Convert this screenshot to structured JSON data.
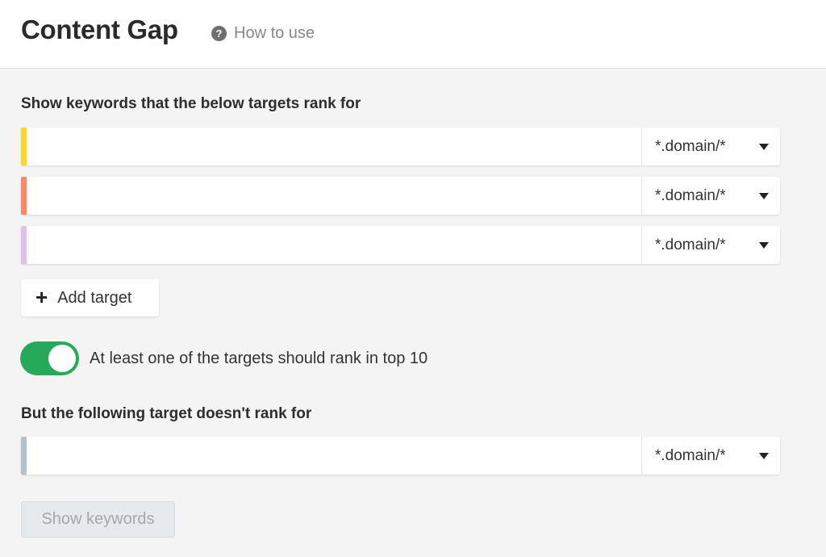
{
  "header": {
    "title": "Content Gap",
    "help_icon": "question-circle-icon",
    "help_link": "How to use"
  },
  "targets_section": {
    "label": "Show keywords that the below targets rank for",
    "targets": [
      {
        "value": "",
        "mode": "*.domain/*",
        "color": "#f8d63a"
      },
      {
        "value": "",
        "mode": "*.domain/*",
        "color": "#f7896c"
      },
      {
        "value": "",
        "mode": "*.domain/*",
        "color": "#dfc1ef"
      }
    ],
    "add_target_label": "Add target"
  },
  "toggle": {
    "on": true,
    "label": "At least one of the targets should rank in top 10",
    "color": "#27a95a"
  },
  "exclude_section": {
    "label": "But the following target doesn't rank for",
    "target": {
      "value": "",
      "mode": "*.domain/*",
      "color": "#b5c0c9"
    }
  },
  "submit": {
    "label": "Show keywords",
    "disabled": true
  }
}
